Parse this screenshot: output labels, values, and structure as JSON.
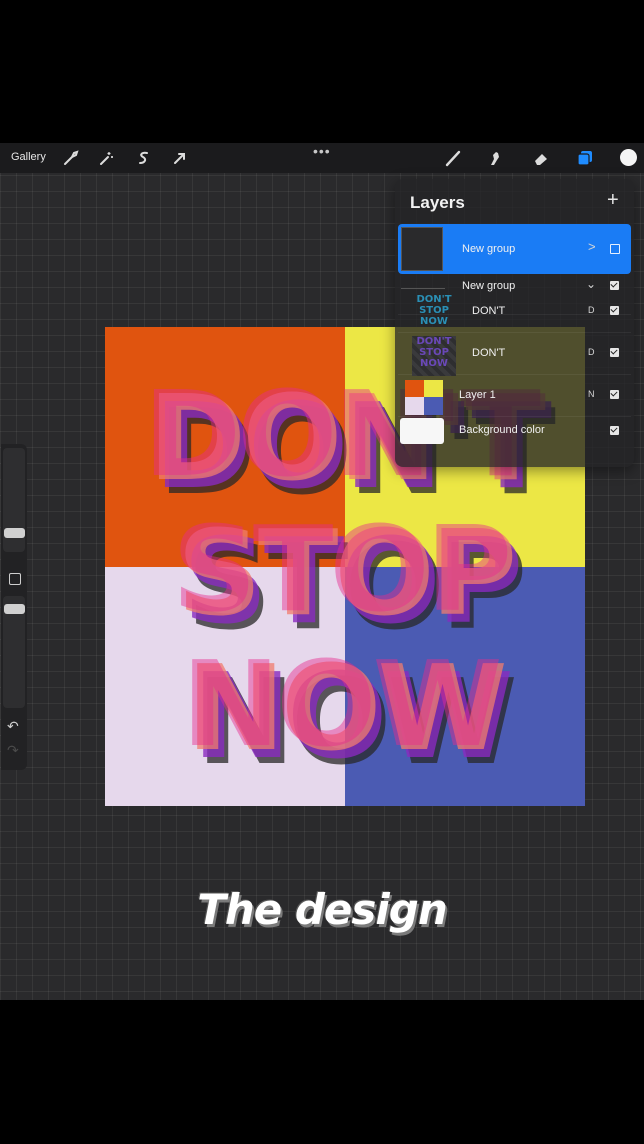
{
  "toolbar": {
    "gallery_label": "Gallery",
    "more_label": "•••",
    "left_tools": [
      "wrench-icon",
      "magic-wand-icon",
      "selection-icon",
      "transform-arrow-icon"
    ],
    "right_tools": [
      "brush-icon",
      "smudge-icon",
      "eraser-icon",
      "layers-icon"
    ],
    "current_color": "#f5f5f5"
  },
  "sidebar": {
    "undo_label": "↶",
    "redo_label": "↷"
  },
  "artwork": {
    "line1": "DON'T",
    "line2": "STOP",
    "line3": "NOW",
    "colors": {
      "top_left": "#e0540f",
      "top_right": "#ece745",
      "bottom_left": "#e6d8ec",
      "bottom_right": "#4b5bb3",
      "text_magenta": "#e62a8f",
      "text_purple": "#8a2bbf",
      "text_salmon": "#f07c6e",
      "text_shadow": "#2b2b2b"
    }
  },
  "layers_panel": {
    "title": "Layers",
    "add_label": "+",
    "layers": [
      {
        "name": "New group",
        "mode": "",
        "visible": false,
        "active": true,
        "indicator": ">"
      },
      {
        "name": "New group",
        "mode": "",
        "visible": true,
        "active": false,
        "indicator": "⌄"
      },
      {
        "name": "DON'T",
        "mode": "D",
        "visible": true,
        "active": false
      },
      {
        "name": "DON'T",
        "mode": "D",
        "visible": true,
        "active": false
      },
      {
        "name": "Layer 1",
        "mode": "N",
        "visible": true,
        "active": false
      },
      {
        "name": "Background color",
        "mode": "",
        "visible": true,
        "active": false
      }
    ],
    "thumb_text": [
      "DON'T",
      "STOP",
      "NOW"
    ]
  },
  "caption": "The design"
}
